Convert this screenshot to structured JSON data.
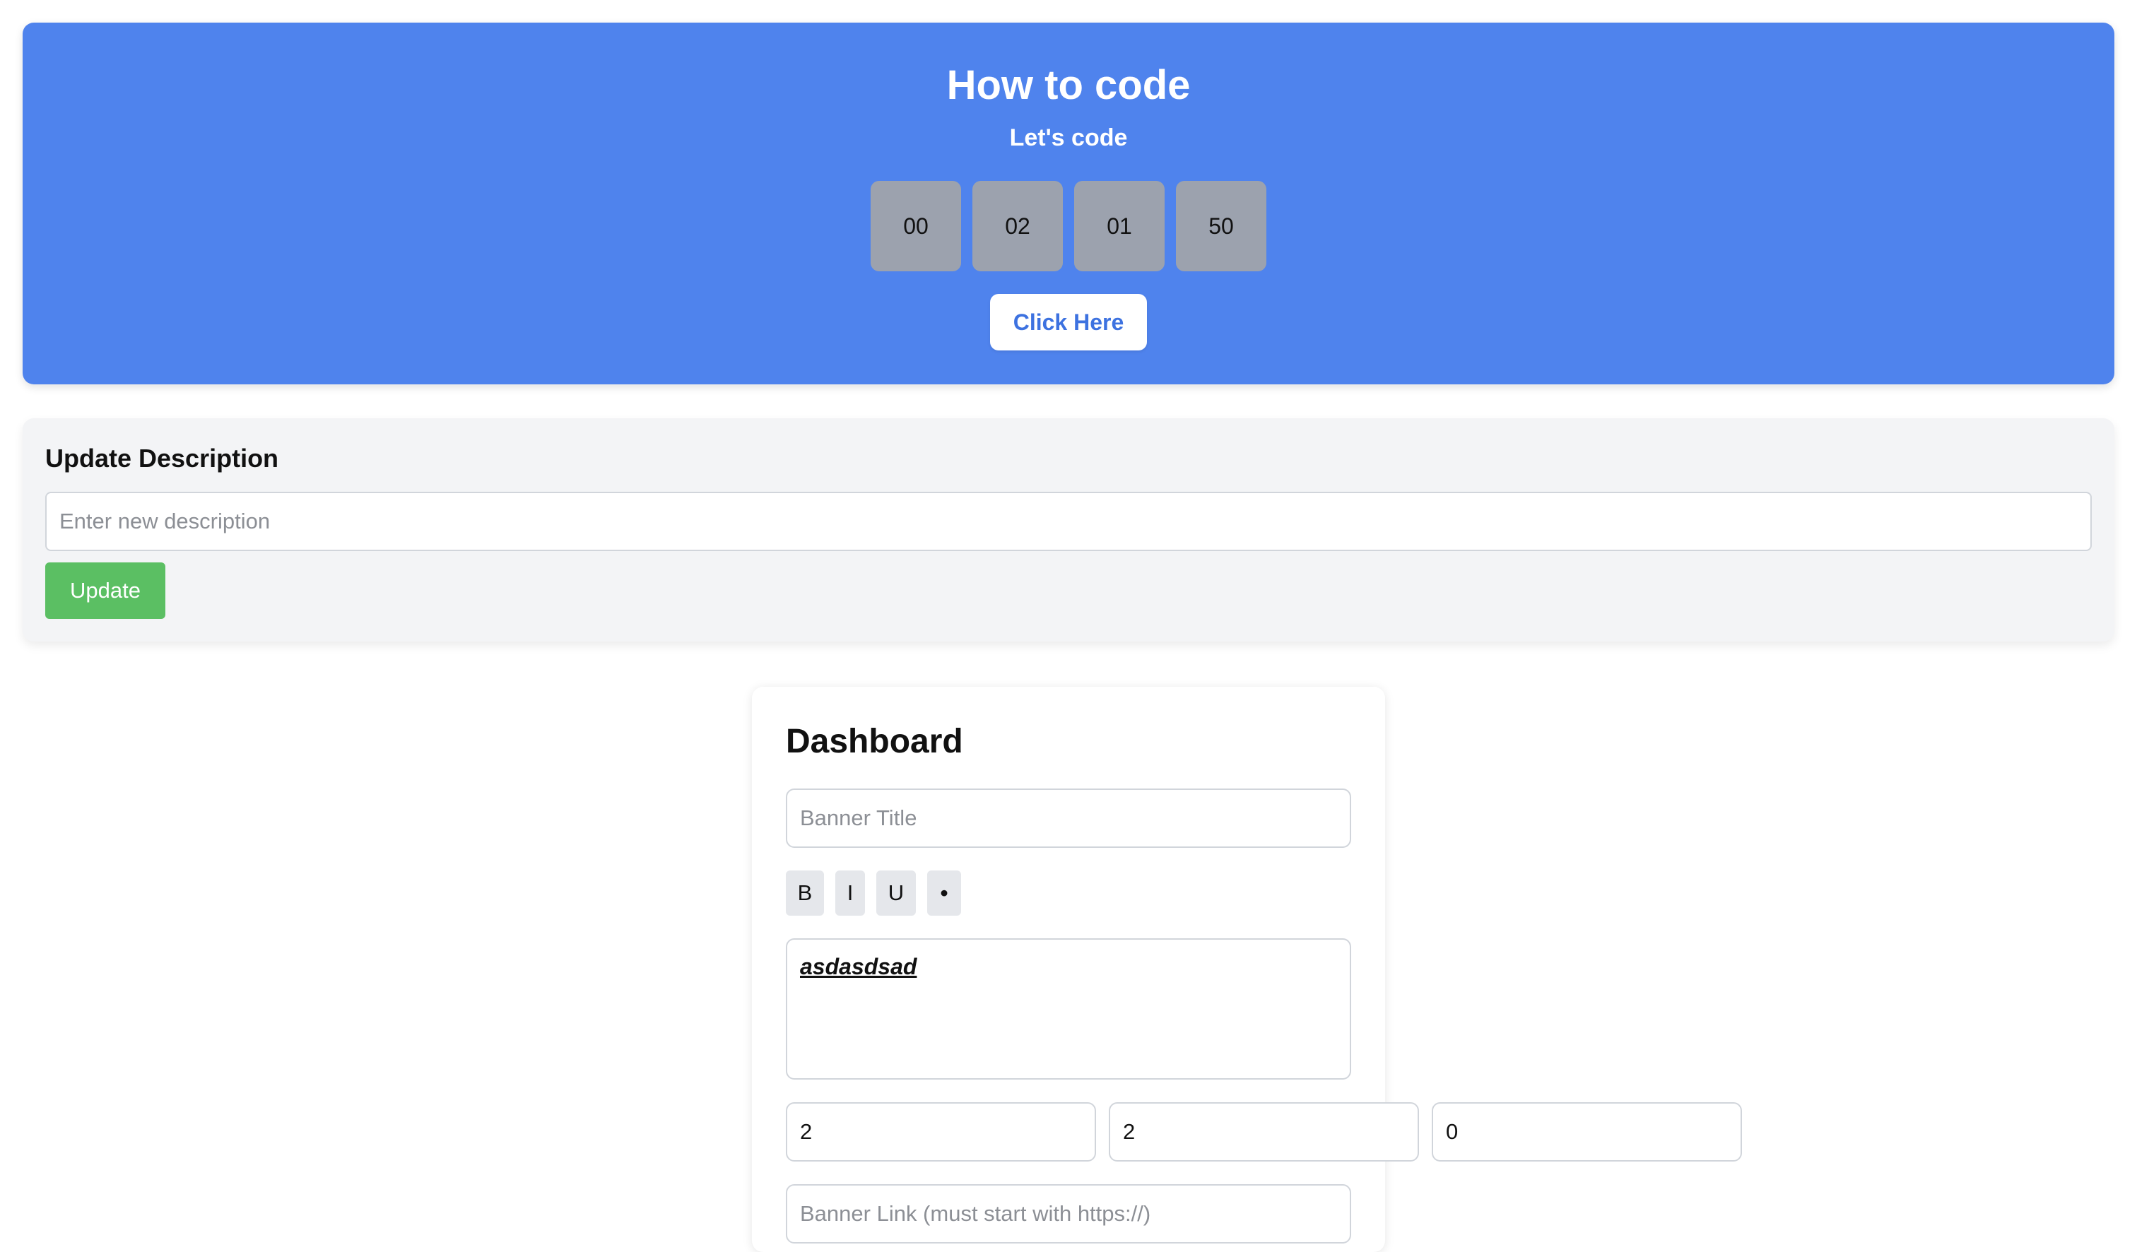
{
  "banner": {
    "title": "How to code",
    "subtitle": "Let's code",
    "countdown": [
      "00",
      "02",
      "01",
      "50"
    ],
    "button_label": "Click Here",
    "background_color": "#4f83ed"
  },
  "description_panel": {
    "heading": "Update Description",
    "input_placeholder": "Enter new description",
    "input_value": "",
    "button_label": "Update",
    "button_color": "#5bbf63"
  },
  "dashboard": {
    "title": "Dashboard",
    "banner_title_placeholder": "Banner Title",
    "banner_title_value": "",
    "toolbar": {
      "bold_label": "B",
      "italic_label": "I",
      "underline_label": "U",
      "bullet_label": "•"
    },
    "editor_text": "asdasdsad",
    "time_fields": [
      "2",
      "2",
      "0"
    ],
    "banner_link_placeholder": "Banner Link (must start with https://)"
  }
}
